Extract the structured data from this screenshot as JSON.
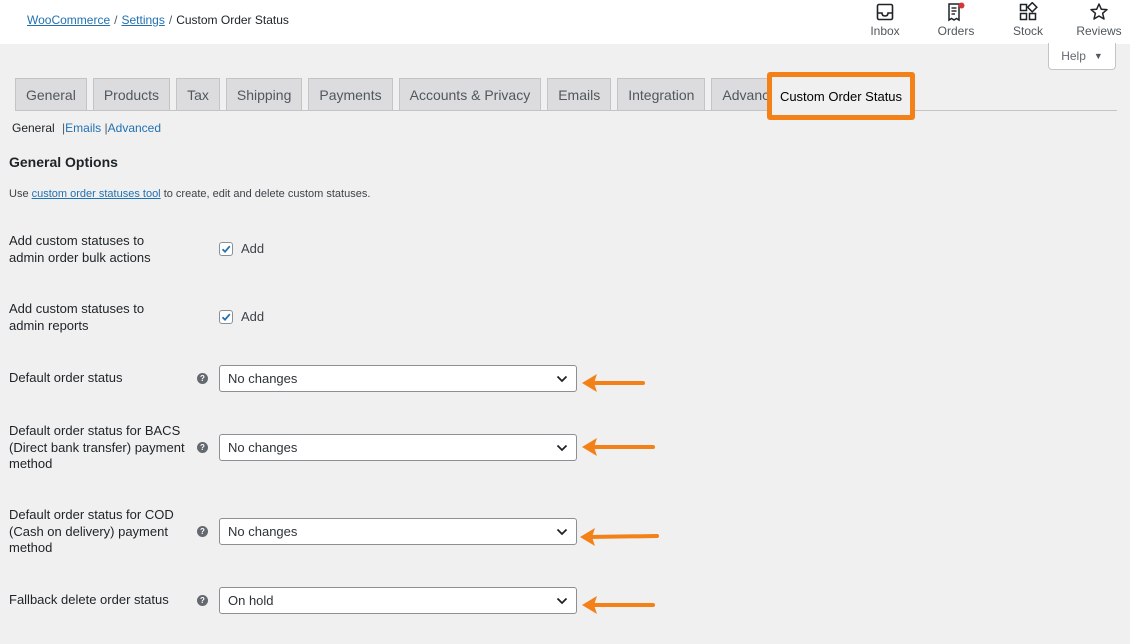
{
  "breadcrumb": {
    "woocommerce": "WooCommerce",
    "settings": "Settings",
    "current": "Custom Order Status",
    "sep": "/"
  },
  "activity": {
    "inbox": "Inbox",
    "orders": "Orders",
    "stock": "Stock",
    "reviews": "Reviews"
  },
  "help": {
    "label": "Help",
    "caret": "▼"
  },
  "tabs": [
    {
      "label": "General"
    },
    {
      "label": "Products"
    },
    {
      "label": "Tax"
    },
    {
      "label": "Shipping"
    },
    {
      "label": "Payments"
    },
    {
      "label": "Accounts & Privacy"
    },
    {
      "label": "Emails"
    },
    {
      "label": "Integration"
    },
    {
      "label": "Advanced"
    }
  ],
  "active_tab": "Custom Order Status",
  "subsub": {
    "general": "General",
    "emails": "Emails",
    "advanced": "Advanced",
    "sep": "|"
  },
  "section": {
    "title": "General Options",
    "desc_prefix": "Use ",
    "desc_link": "custom order statuses tool",
    "desc_suffix": " to create, edit and delete custom statuses."
  },
  "fields": {
    "bulk_actions": {
      "label": "Add custom statuses to admin order bulk actions",
      "checkbox_label": "Add",
      "checked": true
    },
    "reports": {
      "label": "Add custom statuses to admin reports",
      "checkbox_label": "Add",
      "checked": true
    },
    "default_status": {
      "label": "Default order status",
      "value": "No changes"
    },
    "bacs_status": {
      "label": "Default order status for BACS (Direct bank transfer) payment method",
      "value": "No changes"
    },
    "cod_status": {
      "label": "Default order status for COD (Cash on delivery) payment method",
      "value": "No changes"
    },
    "fallback_delete": {
      "label": "Fallback delete order status",
      "value": "On hold"
    }
  },
  "help_tip_glyph": "?",
  "colors": {
    "accent_orange": "#f48018",
    "link_blue": "#2271b1",
    "background": "#f0f0f1",
    "tab_bg": "#dcdcde"
  },
  "icons": {
    "inbox": "inbox-icon",
    "orders": "orders-icon",
    "stock": "stock-icon",
    "reviews": "star-icon"
  }
}
